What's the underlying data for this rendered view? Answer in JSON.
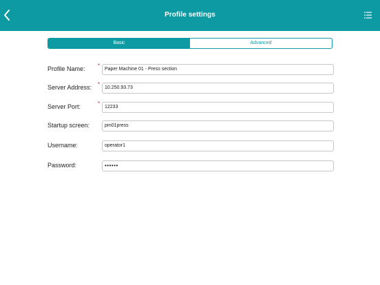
{
  "header": {
    "title": "Profile settings"
  },
  "tabs": [
    {
      "label": "Basic",
      "active": true
    },
    {
      "label": "Advanced",
      "active": false
    }
  ],
  "form": {
    "profile_name": {
      "label": "Profile Name:",
      "value": "Paper Machine 01 - Press section",
      "required": true
    },
    "server_address": {
      "label": "Server Address:",
      "value": "10.250.93.73",
      "required": true
    },
    "server_port": {
      "label": "Server Port:",
      "value": "12233",
      "required": true
    },
    "startup_screen": {
      "label": "Startup screen:",
      "value": "pm01press",
      "required": false
    },
    "username": {
      "label": "Username:",
      "value": "operator1",
      "required": false
    },
    "password": {
      "label": "Password:",
      "value": "••••••",
      "required": false
    }
  },
  "required_marker": "*",
  "colors": {
    "accent": "#0e9aa3",
    "required": "#d81e1e"
  },
  "icons": {
    "back": "chevron-left-icon",
    "menu": "list-menu-icon"
  }
}
